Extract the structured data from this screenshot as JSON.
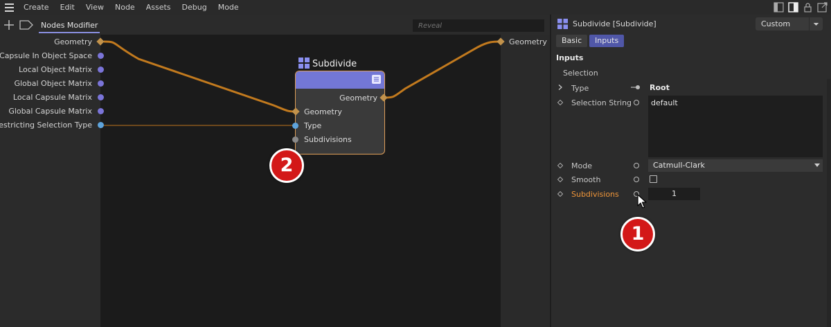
{
  "menu": [
    "Create",
    "Edit",
    "View",
    "Node",
    "Assets",
    "Debug",
    "Mode"
  ],
  "toolbar": {
    "breadcrumb": "Nodes Modifier",
    "search_placeholder": "Reveal"
  },
  "left_ports": [
    {
      "label": "Geometry",
      "kind": "diamond",
      "color": "#c2924b"
    },
    {
      "label": "Capsule In Object Space",
      "kind": "dot",
      "color": "#7a74d8"
    },
    {
      "label": "Local Object Matrix",
      "kind": "dot",
      "color": "#7a74d8"
    },
    {
      "label": "Global Object Matrix",
      "kind": "dot",
      "color": "#7a74d8"
    },
    {
      "label": "Local Capsule Matrix",
      "kind": "dot",
      "color": "#7a74d8"
    },
    {
      "label": "Global Capsule Matrix",
      "kind": "dot",
      "color": "#7a74d8"
    },
    {
      "label": "Restricting Selection Type",
      "kind": "dot",
      "color": "#5ea3db"
    }
  ],
  "node": {
    "title": "Subdivide",
    "header_color": "#7377d6",
    "output": "Geometry",
    "inputs": [
      "Geometry",
      "Type",
      "Subdivisions"
    ]
  },
  "output_port": {
    "label": "Geometry"
  },
  "badges": {
    "one": "1",
    "two": "2"
  },
  "attributes": {
    "title": "Subdivide [Subdivide]",
    "layout_dropdown": "Custom",
    "tabs": [
      "Basic",
      "Inputs"
    ],
    "active_tab": "Inputs",
    "section": "Inputs",
    "group": "Selection",
    "rows": {
      "type": {
        "label": "Type",
        "value": "Root"
      },
      "selection_string": {
        "label": "Selection String",
        "value": "default"
      },
      "mode": {
        "label": "Mode",
        "value": "Catmull-Clark"
      },
      "smooth": {
        "label": "Smooth",
        "checked": false
      },
      "subdivisions": {
        "label": "Subdivisions",
        "value": "1"
      }
    }
  },
  "colors": {
    "wire": "#c27a1e",
    "accent": "#5057a8",
    "badge": "#d31818"
  }
}
